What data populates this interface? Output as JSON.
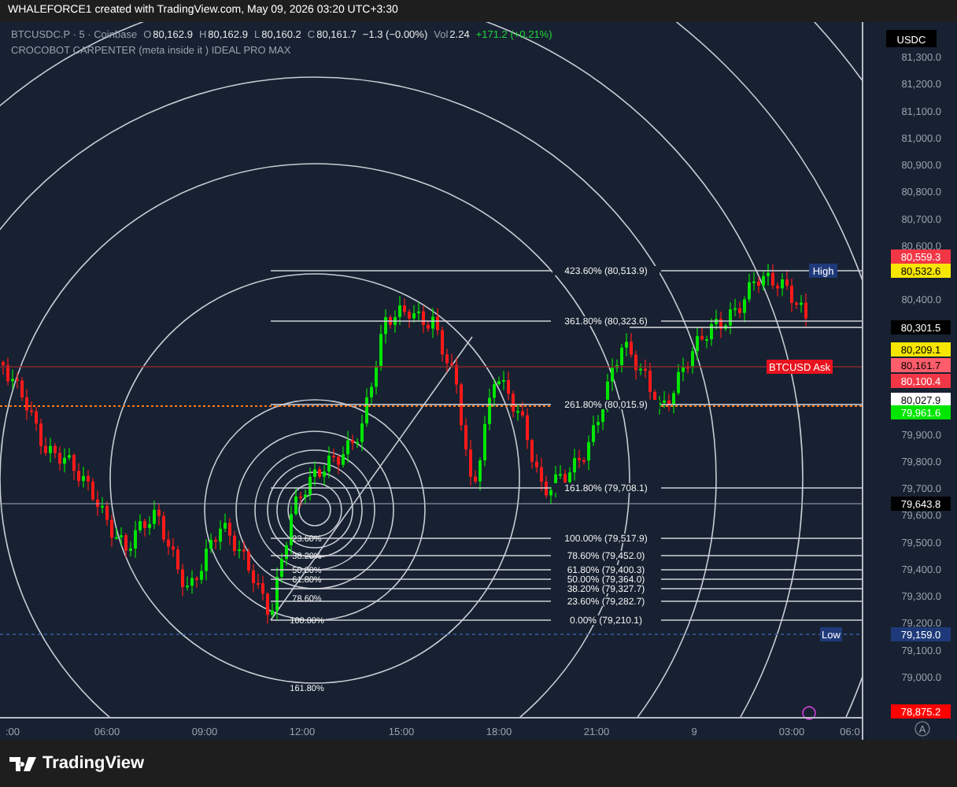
{
  "header": {
    "text": "WHALEFORCE1 created with TradingView.com, May 09, 2026 03:20 UTC+3:30"
  },
  "legend": {
    "symbol": "BTCUSDC.P · 5 · Coinbase",
    "ohlc": [
      {
        "label": "O",
        "value": "80,162.9"
      },
      {
        "label": "H",
        "value": "80,162.9"
      },
      {
        "label": "L",
        "value": "80,160.2"
      },
      {
        "label": "C",
        "value": "80,161.7"
      }
    ],
    "change": "−1.3 (−0.00%)",
    "volume_label": "Vol",
    "volume": "2.24",
    "volume_change": "+171.2 (+0.21%)",
    "indicator": "CROCOBOT CARPENTER (meta inside it ) IDEAL PRO MAX"
  },
  "fib_levels": [
    {
      "text": "423.60% (80,513.9)"
    },
    {
      "text": "361.80% (80,323.6)"
    },
    {
      "text": "261.80% (80,015.9)"
    },
    {
      "text": "161.80% (79,708.1)"
    },
    {
      "text": "100.00% (79,517.9)"
    },
    {
      "text": "78.60% (79,452.0)"
    },
    {
      "text": "61.80% (79,400.3)"
    },
    {
      "text": "50.00% (79,364.0)"
    },
    {
      "text": "38.20% (79,327.7)"
    },
    {
      "text": "23.60% (79,282.7)"
    },
    {
      "text": "0.00% (79,210.1)"
    }
  ],
  "fib_circle_labels": [
    "23.60%",
    "38.20%",
    "50.00%",
    "61.80%",
    "78.60%",
    "100.00%",
    "161.80%"
  ],
  "tags": [
    {
      "text": "High",
      "color": "#1e3a7a"
    },
    {
      "text": "BTCUSD Ask",
      "color": "#e8121e"
    },
    {
      "text": "Low",
      "color": "#1e3a7a"
    }
  ],
  "price_axis": {
    "currency": "USDC",
    "ticks": [
      "81,300.0",
      "81,200.0",
      "81,100.0",
      "81,000.0",
      "80,900.0",
      "80,800.0",
      "80,700.0",
      "80,600.0",
      "80,400.0",
      "79,900.0",
      "79,800.0",
      "79,700.0",
      "79,600.0",
      "79,500.0",
      "79,400.0",
      "79,300.0",
      "79,200.0",
      "79,100.0",
      "79,000.0"
    ],
    "badges": [
      {
        "text": "80,559.3",
        "color": "#f23645"
      },
      {
        "text": "80,532.6",
        "color": "#f7e600"
      },
      {
        "text": "80,301.5",
        "color": "#000000"
      },
      {
        "text": "80,209.1",
        "color": "#f7e600"
      },
      {
        "text": "80,161.7",
        "color": "#ff5d6c"
      },
      {
        "text": "80,100.4",
        "color": "#f23645"
      },
      {
        "text": "80,027.9",
        "color": "#ffffff"
      },
      {
        "text": "79,961.6",
        "color": "#00e600"
      },
      {
        "text": "79,643.8",
        "color": "#000000"
      },
      {
        "text": "79,159.0",
        "color": "#1e3a7a"
      },
      {
        "text": "78,875.2",
        "color": "#ff0000"
      }
    ],
    "auto_button": "A"
  },
  "time_axis": [
    ":00",
    "06:00",
    "09:00",
    "12:00",
    "15:00",
    "18:00",
    "21:00",
    "9",
    "03:00",
    "06:0"
  ],
  "footer": {
    "logo": "TradingView"
  }
}
